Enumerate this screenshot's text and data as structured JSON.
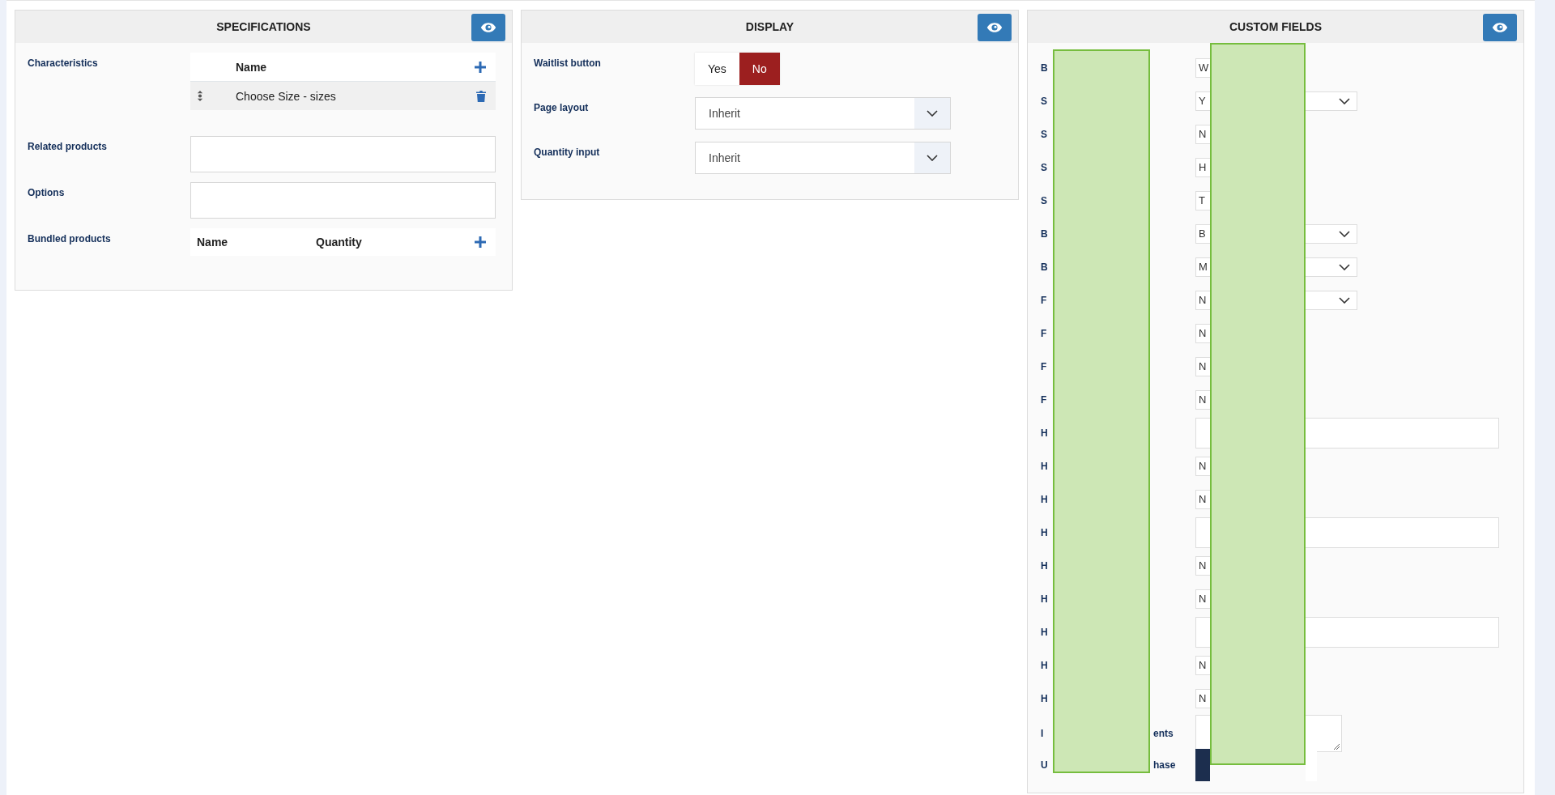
{
  "specifications": {
    "title": "SPECIFICATIONS",
    "characteristics": {
      "label": "Characteristics",
      "column": "Name",
      "rows": [
        {
          "name": "Choose Size - sizes"
        }
      ]
    },
    "related_products": {
      "label": "Related products"
    },
    "options": {
      "label": "Options"
    },
    "bundled_products": {
      "label": "Bundled products",
      "columns": [
        "Name",
        "Quantity"
      ]
    }
  },
  "display": {
    "title": "DISPLAY",
    "waitlist": {
      "label": "Waitlist button",
      "options": [
        {
          "label": "Yes",
          "selected": false
        },
        {
          "label": "No",
          "selected": true
        }
      ]
    },
    "selects": [
      {
        "label": "Page layout",
        "value": "Inherit"
      },
      {
        "label": "Quantity input",
        "value": "Inherit"
      }
    ]
  },
  "custom_fields": {
    "title": "CUSTOM FIELDS",
    "fields": [
      {
        "label": "B",
        "kind": "input",
        "value": "W"
      },
      {
        "label": "S",
        "kind": "select",
        "value": "Y"
      },
      {
        "label": "S",
        "kind": "input",
        "value": "N"
      },
      {
        "label": "S",
        "kind": "input",
        "value": "H"
      },
      {
        "label": "S",
        "kind": "input",
        "value": "T"
      },
      {
        "label": "B",
        "kind": "select",
        "value": "B"
      },
      {
        "label": "B",
        "kind": "select",
        "value": "M"
      },
      {
        "label": "F",
        "kind": "select",
        "value": "N"
      },
      {
        "label": "F",
        "kind": "input",
        "value": "N"
      },
      {
        "label": "F",
        "kind": "input",
        "value": "N"
      },
      {
        "label": "F",
        "kind": "input",
        "value": "N"
      },
      {
        "label": "H",
        "kind": "wide"
      },
      {
        "label": "H",
        "kind": "input",
        "value": "N"
      },
      {
        "label": "H",
        "kind": "input",
        "value": "N"
      },
      {
        "label": "H",
        "kind": "wide"
      },
      {
        "label": "H",
        "kind": "input",
        "value": "N"
      },
      {
        "label": "H",
        "kind": "input",
        "value": "N"
      },
      {
        "label": "H",
        "kind": "wide"
      },
      {
        "label": "H",
        "kind": "input",
        "value": "N"
      },
      {
        "label": "H",
        "kind": "input",
        "value": "N"
      },
      {
        "label": "I",
        "label_end": "ents",
        "kind": "textarea"
      },
      {
        "label": "U",
        "label_end": "hase",
        "kind": "toggle",
        "options": [
          {
            "selected": true
          },
          {
            "selected": false
          }
        ]
      }
    ]
  }
}
